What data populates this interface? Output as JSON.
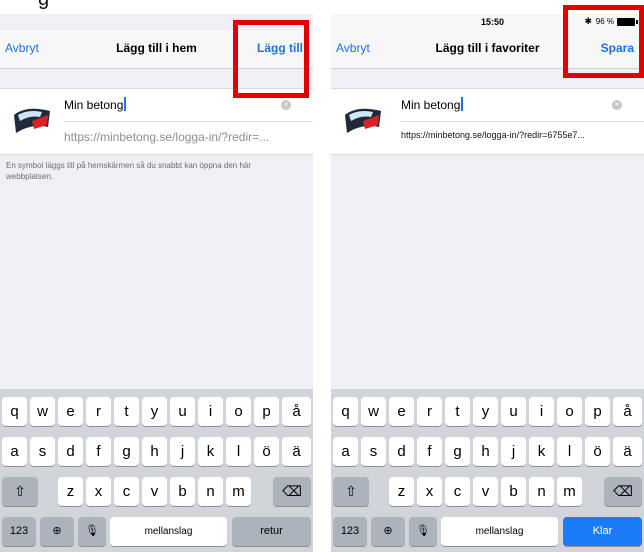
{
  "caption": "g",
  "left": {
    "nav": {
      "cancel": "Avbryt",
      "title": "Lägg till i hem",
      "action": "Lägg till"
    },
    "bookmark": {
      "title": "Min betong",
      "url": "https://minbetong.se/logga-in/?redir=..."
    },
    "hint": "En symbol läggs till på hemskärmen så du snabbt kan öppna den här webbplatsen.",
    "keyboard": {
      "row1": [
        "q",
        "w",
        "e",
        "r",
        "t",
        "y",
        "u",
        "i",
        "o",
        "p",
        "å"
      ],
      "row2": [
        "a",
        "s",
        "d",
        "f",
        "g",
        "h",
        "j",
        "k",
        "l",
        "ö",
        "ä"
      ],
      "row3": [
        "z",
        "x",
        "c",
        "v",
        "b",
        "n",
        "m"
      ],
      "numbers": "123",
      "space": "mellanslag",
      "return": "retur"
    }
  },
  "right": {
    "status": {
      "time": "15:50",
      "battery": "96 %"
    },
    "nav": {
      "cancel": "Avbryt",
      "title": "Lägg till i favoriter",
      "action": "Spara"
    },
    "bookmark": {
      "title": "Min betong",
      "url": "https://minbetong.se/logga-in/?redir=6755e7..."
    },
    "keyboard": {
      "row1": [
        "q",
        "w",
        "e",
        "r",
        "t",
        "y",
        "u",
        "i",
        "o",
        "p",
        "å"
      ],
      "row2": [
        "a",
        "s",
        "d",
        "f",
        "g",
        "h",
        "j",
        "k",
        "l",
        "ö",
        "ä"
      ],
      "row3": [
        "z",
        "x",
        "c",
        "v",
        "b",
        "n",
        "m"
      ],
      "numbers": "123",
      "space": "mellanslag",
      "return": "Klar"
    }
  },
  "colors": {
    "accent": "#1a74e8",
    "highlight": "#e30000",
    "keyboard": "#d1d4d9"
  },
  "icons": [
    "shift-icon",
    "backspace-icon",
    "globe-icon",
    "microphone-icon",
    "clear-icon",
    "bluetooth-icon",
    "battery-icon"
  ]
}
